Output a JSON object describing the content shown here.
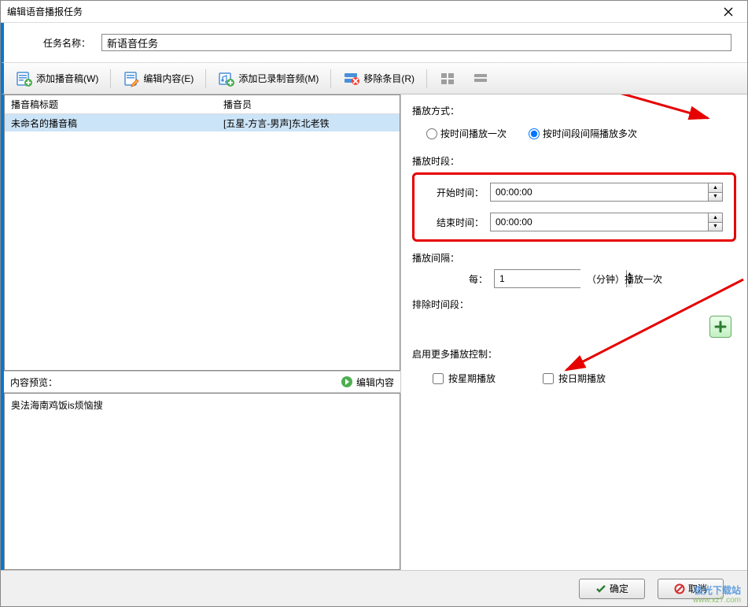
{
  "window": {
    "title": "编辑语音播报任务"
  },
  "task_name": {
    "label": "任务名称：",
    "value": "新语音任务"
  },
  "toolbar": {
    "add_script": "添加播音稿(W)",
    "edit_content": "编辑内容(E)",
    "add_recorded": "添加已录制音频(M)",
    "remove_item": "移除条目(R)"
  },
  "list": {
    "col_title": "播音稿标题",
    "col_voicer": "播音员",
    "rows": [
      {
        "title": "未命名的播音稿",
        "voicer": "[五星-方言-男声]东北老铁"
      }
    ]
  },
  "preview": {
    "label": "内容预览：",
    "edit_link": "编辑内容",
    "text": "奥法海南鸡饭is烦恼搜"
  },
  "playback": {
    "mode_label": "播放方式：",
    "mode_once": "按时间播放一次",
    "mode_multi": "按时间段间隔播放多次",
    "period_label": "播放时段：",
    "start_label": "开始时间：",
    "start_value": "00:00:00",
    "end_label": "结束时间：",
    "end_value": "00:00:00",
    "interval_label": "播放间隔：",
    "every_label": "每：",
    "interval_value": "1",
    "interval_suffix": "（分钟）播放一次",
    "exclude_label": "排除时间段：",
    "more_label": "启用更多播放控制：",
    "by_week": "按星期播放",
    "by_date": "按日期播放"
  },
  "buttons": {
    "ok": "确定",
    "cancel": "取消"
  },
  "watermark": {
    "line1": "极光下载站",
    "line2": "www.xz7.com"
  }
}
